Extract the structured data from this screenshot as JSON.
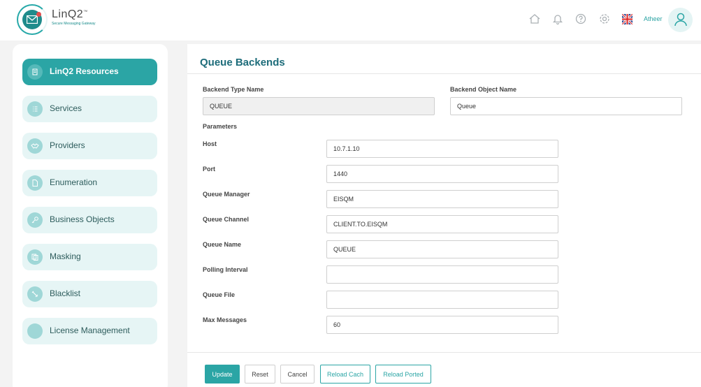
{
  "header": {
    "brand": "LinQ2",
    "brand_mark": "™",
    "tagline": "Secure Messaging Gateway",
    "username": "Atheer",
    "icons": [
      "home-icon",
      "bell-icon",
      "help-icon",
      "gear-icon",
      "uk-flag-icon",
      "user-icon"
    ]
  },
  "sidebar": {
    "items": [
      {
        "label": "LinQ2 Resources",
        "icon": "database-icon",
        "active": true
      },
      {
        "label": "Services",
        "icon": "list-icon"
      },
      {
        "label": "Providers",
        "icon": "handshake-icon"
      },
      {
        "label": "Enumeration",
        "icon": "document-icon"
      },
      {
        "label": "Business Objects",
        "icon": "key-icon"
      },
      {
        "label": "Masking",
        "icon": "copy-icon"
      },
      {
        "label": "Blacklist",
        "icon": "block-icon"
      },
      {
        "label": "License Management",
        "icon": "license-icon"
      }
    ]
  },
  "main": {
    "title": "Queue Backends",
    "backend_type_label": "Backend Type Name",
    "backend_type_value": "QUEUE",
    "backend_object_label": "Backend Object Name",
    "backend_object_value": "Queue",
    "parameters_label": "Parameters",
    "params": [
      {
        "label": "Host",
        "value": "10.7.1.10"
      },
      {
        "label": "Port",
        "value": "1440"
      },
      {
        "label": "Queue Manager",
        "value": "EISQM"
      },
      {
        "label": "Queue Channel",
        "value": "CLIENT.TO.EISQM"
      },
      {
        "label": "Queue Name",
        "value": "QUEUE"
      },
      {
        "label": "Polling Interval",
        "value": ""
      },
      {
        "label": "Queue File",
        "value": ""
      },
      {
        "label": "Max Messages",
        "value": "60"
      }
    ],
    "buttons": {
      "update": "Update",
      "reset": "Reset",
      "cancel": "Cancel",
      "reload_cach": "Reload Cach",
      "reload_ported": "Reload Ported"
    }
  },
  "colors": {
    "accent": "#2ba5a5",
    "title": "#1d6c7a",
    "nav_bg": "#e6f5f5"
  }
}
